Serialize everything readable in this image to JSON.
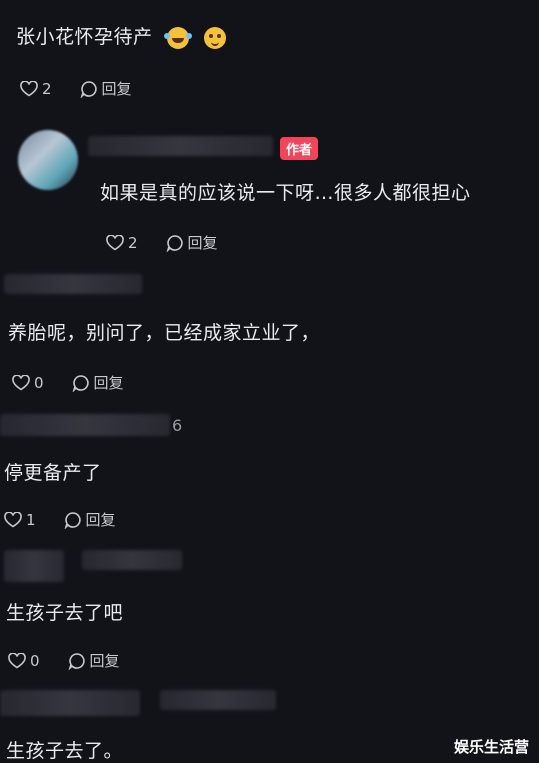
{
  "comments": [
    {
      "text": "张小花怀孕待产",
      "likes": "2",
      "reply_label": "回复",
      "emojis": [
        "laughing-tears-emoji",
        "smirk-emoji"
      ]
    },
    {
      "author_badge": "作者",
      "text": "如果是真的应该说一下呀…很多人都很担心",
      "likes": "2",
      "reply_label": "回复"
    },
    {
      "text": "养胎呢，别问了，已经成家立业了，",
      "likes": "0",
      "reply_label": "回复"
    },
    {
      "username_tail": "6",
      "text": "停更备产了",
      "likes": "1",
      "reply_label": "回复"
    },
    {
      "text": "生孩子去了吧",
      "likes": "0",
      "reply_label": "回复"
    },
    {
      "text": "生孩子去了。"
    }
  ],
  "watermark": "娱乐生活营",
  "colors": {
    "background": "#121219",
    "badge": "#f2455a",
    "text": "#eaeaf0"
  }
}
